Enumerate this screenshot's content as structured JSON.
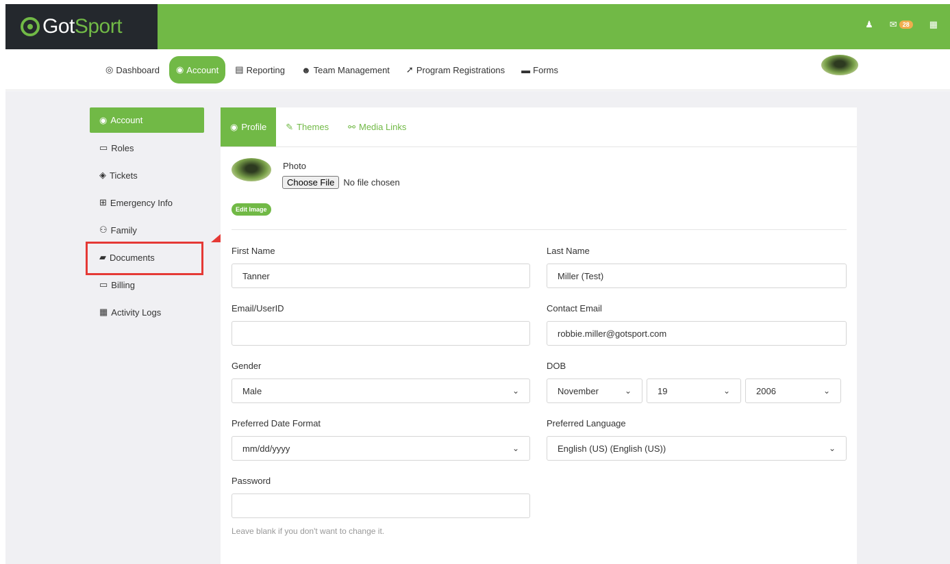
{
  "app": {
    "logo_prefix": "",
    "logo_text_1": "Got",
    "logo_text_2": "Sport"
  },
  "topbar": {
    "user_icon": "user-icon",
    "mail_icon": "envelope-icon",
    "mail_count": "28",
    "apps_icon": "grid-icon"
  },
  "nav": [
    {
      "icon": "◎",
      "label": "Dashboard",
      "active": false
    },
    {
      "icon": "◉",
      "label": "Account",
      "active": true
    },
    {
      "icon": "▤",
      "label": "Reporting",
      "active": false
    },
    {
      "icon": "☻",
      "label": "Team Management",
      "active": false
    },
    {
      "icon": "➚",
      "label": "Program Registrations",
      "active": false
    },
    {
      "icon": "▬",
      "label": "Forms",
      "active": false
    }
  ],
  "sidebar": {
    "items": [
      {
        "icon": "◉",
        "label": "Account"
      },
      {
        "icon": "▭",
        "label": "Roles"
      },
      {
        "icon": "◈",
        "label": "Tickets"
      },
      {
        "icon": "⊞",
        "label": "Emergency Info"
      },
      {
        "icon": "⚇",
        "label": "Family"
      },
      {
        "icon": "▰",
        "label": "Documents"
      },
      {
        "icon": "▭",
        "label": "Billing"
      },
      {
        "icon": "▦",
        "label": "Activity Logs"
      }
    ]
  },
  "tabs": [
    {
      "icon": "◉",
      "label": "Profile"
    },
    {
      "icon": "✎",
      "label": "Themes"
    },
    {
      "icon": "⚯",
      "label": "Media Links"
    }
  ],
  "profile": {
    "photo_label": "Photo",
    "choose_file": "Choose File",
    "no_file": "No file chosen",
    "edit_image": "Edit Image",
    "first_name_label": "First Name",
    "first_name": "Tanner",
    "last_name_label": "Last Name",
    "last_name": "Miller (Test)",
    "email_label": "Email/UserID",
    "email": "",
    "contact_email_label": "Contact Email",
    "contact_email": "robbie.miller@gotsport.com",
    "gender_label": "Gender",
    "gender": "Male",
    "dob_label": "DOB",
    "dob_month": "November",
    "dob_day": "19",
    "dob_year": "2006",
    "date_format_label": "Preferred Date Format",
    "date_format": "mm/dd/yyyy",
    "language_label": "Preferred Language",
    "language": "English (US) (English (US))",
    "password_label": "Password",
    "password": "",
    "password_help": "Leave blank if you don't want to change it."
  },
  "colors": {
    "brand": "#71b946",
    "dark": "#24282d",
    "highlight": "#e53935"
  }
}
